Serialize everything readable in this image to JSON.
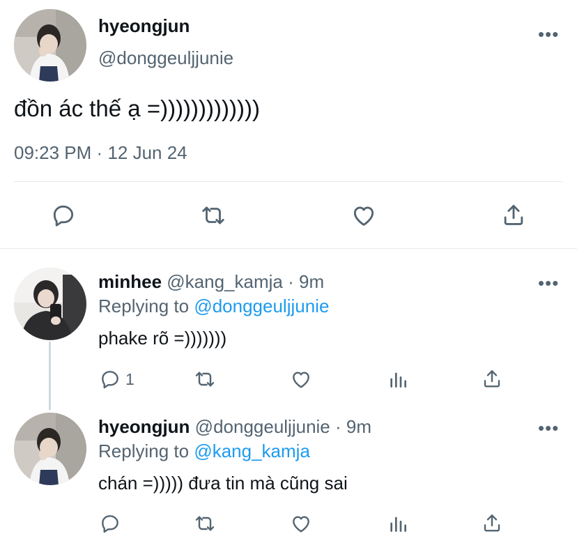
{
  "main_tweet": {
    "display_name": "hyeongjun",
    "handle": "@donggeuljjunie",
    "text": "đồn ác thế ạ =)))))))))))))",
    "time": "09:23 PM",
    "date": "12 Jun 24",
    "more": "•••"
  },
  "replies": [
    {
      "display_name": "minhee",
      "handle": "@kang_kamja",
      "age": "9m",
      "replying_label": "Replying to",
      "replying_to": "@donggeuljjunie",
      "text": "phake rõ =)))))))",
      "reply_count": "1",
      "more": "•••"
    },
    {
      "display_name": "hyeongjun",
      "handle": "@donggeuljjunie",
      "age": "9m",
      "replying_label": "Replying to",
      "replying_to": "@kang_kamja",
      "text": "chán =))))) đưa tin mà cũng sai",
      "reply_count": "",
      "more": "•••"
    }
  ],
  "separator": "·",
  "colors": {
    "accent": "#1d9bf0",
    "muted": "#536471",
    "text": "#0f1419",
    "divider": "#e6e9ec"
  },
  "icons": [
    "reply-icon",
    "retweet-icon",
    "like-icon",
    "share-icon",
    "analytics-icon",
    "more-icon"
  ]
}
